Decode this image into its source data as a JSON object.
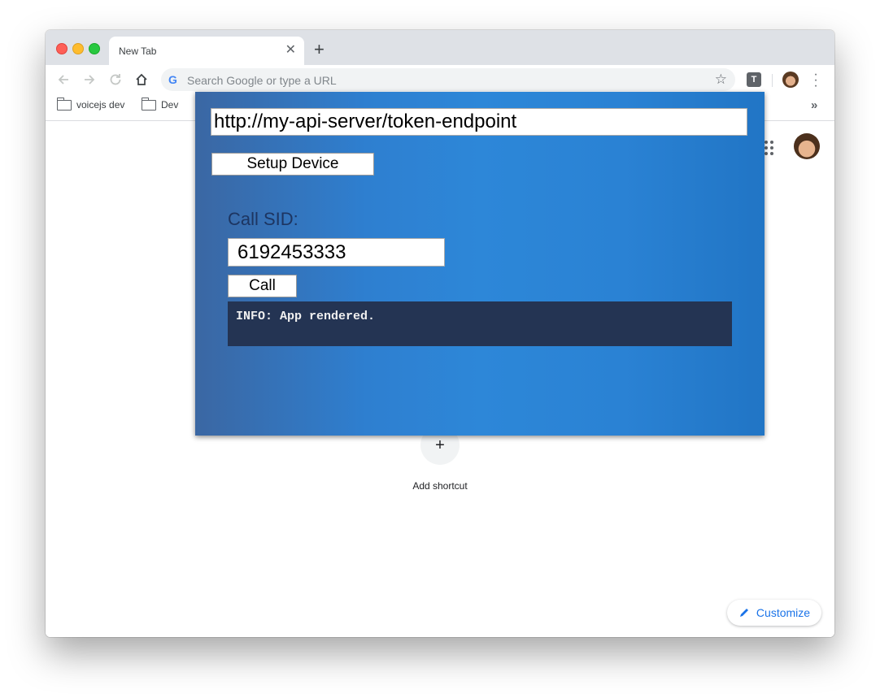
{
  "browser": {
    "tab_title": "New Tab",
    "tab_close": "✕",
    "new_tab": "+",
    "omnibox_placeholder": "Search Google or type a URL",
    "extension_label": "T"
  },
  "bookmarks": [
    {
      "label": "voicejs dev"
    },
    {
      "label": "Dev"
    }
  ],
  "bookmarks_overflow": "»",
  "new_tab_page": {
    "add_shortcut_symbol": "+",
    "add_shortcut_label": "Add shortcut",
    "customize_label": "Customize"
  },
  "popup": {
    "token_url": "http://my-api-server/token-endpoint",
    "setup_button": "Setup Device",
    "call_sid_label": "Call SID:",
    "call_sid_value": "6192453333",
    "call_button": "Call",
    "log_lines": [
      "INFO: App rendered."
    ]
  },
  "colors": {
    "popup_gradient_start": "#3b67a3",
    "popup_gradient_mid": "#2d87d8",
    "log_background": "#243453",
    "link_blue": "#1a73e8"
  }
}
